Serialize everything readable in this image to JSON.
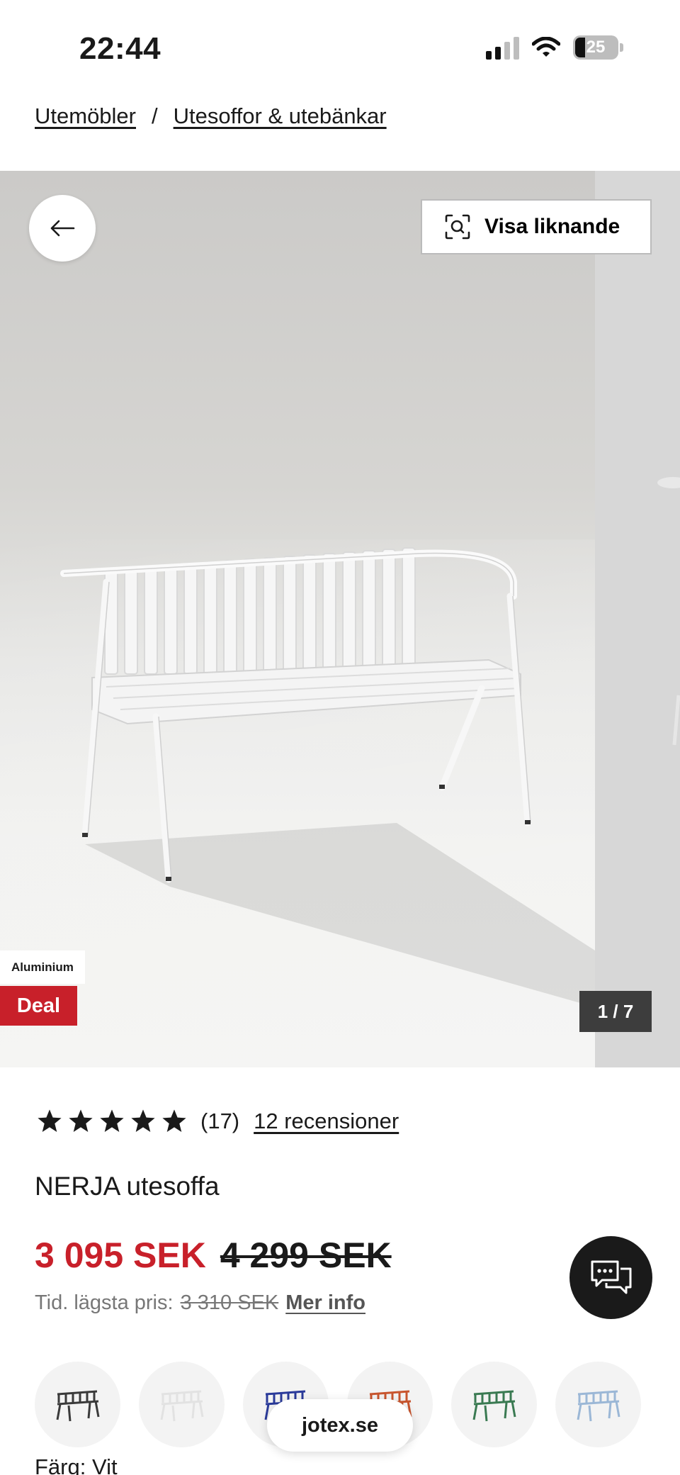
{
  "status_bar": {
    "time": "22:44",
    "battery": "25"
  },
  "breadcrumb": [
    {
      "label": "Utemöbler"
    },
    {
      "label": "Utesoffor & utebänkar"
    }
  ],
  "breadcrumb_separator": "/",
  "hero": {
    "similar_button": "Visa liknande",
    "material_tag": "Aluminium",
    "deal_tag": "Deal",
    "image_counter": "1 / 7",
    "colors": {
      "deal": "#c8202a",
      "counter_bg": "#3d3d3d"
    }
  },
  "product": {
    "rating_stars": 5,
    "rating_count": "(17)",
    "reviews_link": "12 recensioner",
    "name": "NERJA utesoffa",
    "price_now": "3 095 SEK",
    "price_old": "4 299 SEK",
    "lowest_label": "Tid. lägsta pris:",
    "lowest_value": "3 310 SEK",
    "more_info": "Mer info",
    "color_label": "Färg: Vit"
  },
  "swatches": [
    {
      "name": "black",
      "color": "#3a3a3a"
    },
    {
      "name": "white",
      "color": "#e2e2e2"
    },
    {
      "name": "blue",
      "color": "#2a3a9a"
    },
    {
      "name": "rust",
      "color": "#c8552e"
    },
    {
      "name": "green",
      "color": "#3a7a52"
    },
    {
      "name": "light-blue",
      "color": "#9bb7d6"
    }
  ],
  "site_pill": "jotex.se",
  "accent_color": "#c8202a"
}
